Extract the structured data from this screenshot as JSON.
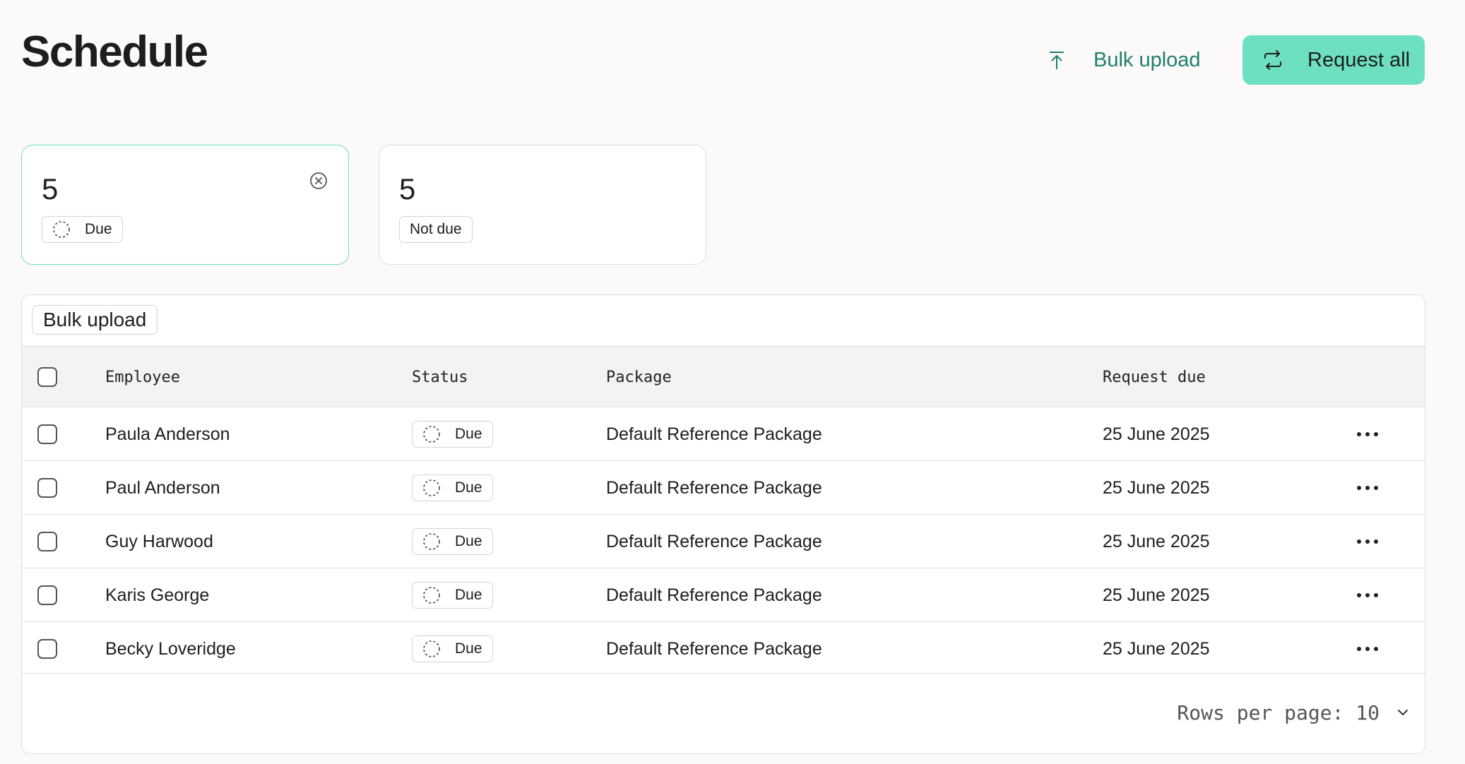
{
  "header": {
    "title": "Schedule",
    "bulk_upload_label": "Bulk upload",
    "request_all_label": "Request all"
  },
  "colors": {
    "accent": "#6ee0c2",
    "accent_text": "#1f7f6e",
    "active_border": "#72dcc0"
  },
  "stats": [
    {
      "count": "5",
      "label": "Due",
      "icon": "dashed-circle-icon",
      "active": true
    },
    {
      "count": "5",
      "label": "Not due",
      "active": false
    }
  ],
  "table": {
    "toolbar_button": "Bulk upload",
    "columns": {
      "employee": "Employee",
      "status": "Status",
      "package": "Package",
      "request_due": "Request due"
    },
    "rows": [
      {
        "employee": "Paula Anderson",
        "status": "Due",
        "package": "Default Reference Package",
        "request_due": "25 June 2025"
      },
      {
        "employee": "Paul Anderson",
        "status": "Due",
        "package": "Default Reference Package",
        "request_due": "25 June 2025"
      },
      {
        "employee": "Guy Harwood",
        "status": "Due",
        "package": "Default Reference Package",
        "request_due": "25 June 2025"
      },
      {
        "employee": "Karis George",
        "status": "Due",
        "package": "Default Reference Package",
        "request_due": "25 June 2025"
      },
      {
        "employee": "Becky Loveridge",
        "status": "Due",
        "package": "Default Reference Package",
        "request_due": "25 June 2025"
      }
    ],
    "footer": {
      "rows_per_page_label": "Rows per page: 10"
    }
  }
}
